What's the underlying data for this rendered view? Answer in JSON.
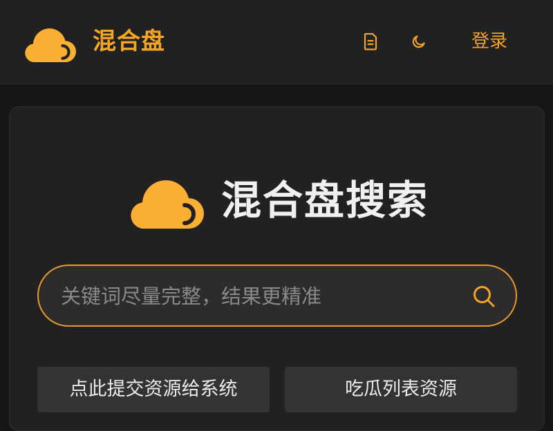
{
  "header": {
    "brand": "混合盘",
    "login_label": "登录",
    "icons": [
      "doc-icon",
      "moon-icon"
    ]
  },
  "hero": {
    "title": "混合盘搜索"
  },
  "search": {
    "placeholder": "关键词尽量完整，结果更精准",
    "value": ""
  },
  "actions": {
    "submit_label": "点此提交资源给系统",
    "list_label": "吃瓜列表资源"
  },
  "colors": {
    "accent": "#f5a524",
    "logo": "#fbb034",
    "background": "#161616",
    "panel": "#212121",
    "button": "#333333"
  }
}
